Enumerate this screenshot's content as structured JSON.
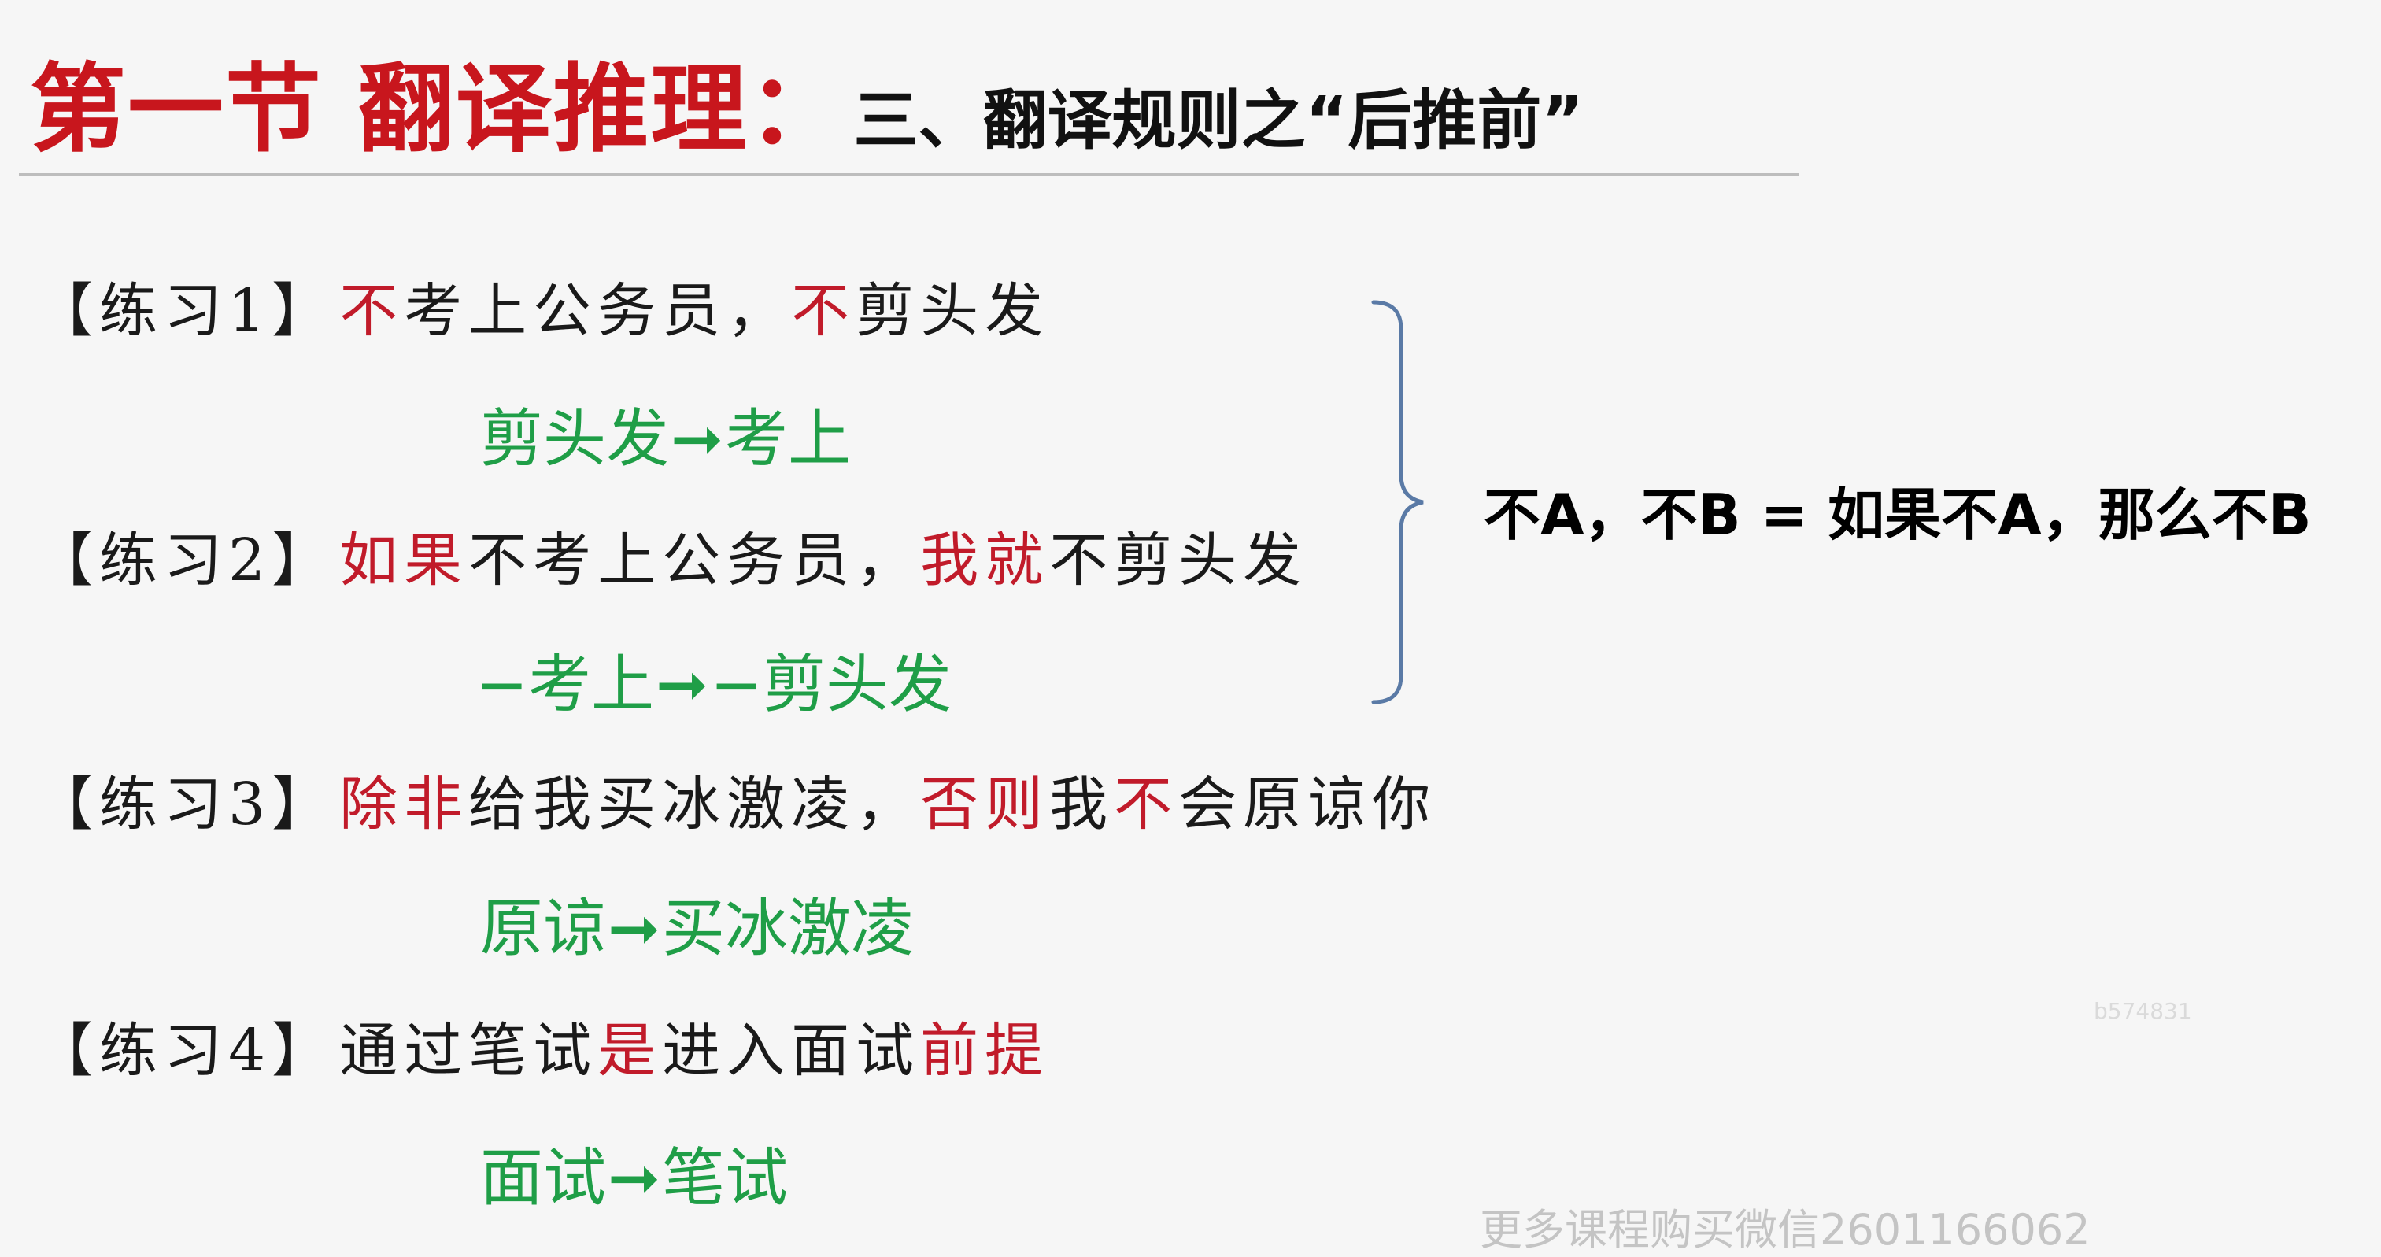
{
  "title": {
    "main": "第一节 翻译推理：",
    "sub": "三、翻译规则之“后推前”"
  },
  "exercises": [
    {
      "label": "【练习1】",
      "sentence": [
        {
          "t": "不",
          "red": true
        },
        {
          "t": "考上公务员，",
          "red": false
        },
        {
          "t": "不",
          "red": true
        },
        {
          "t": "剪头发",
          "red": false
        }
      ],
      "answer": {
        "from": "剪头发",
        "arrow": "➞",
        "to": "考上"
      }
    },
    {
      "label": "【练习2】",
      "sentence": [
        {
          "t": "如果",
          "red": true
        },
        {
          "t": "不考上公务员，",
          "red": false
        },
        {
          "t": "我就",
          "red": true
        },
        {
          "t": "不剪头发",
          "red": false
        }
      ],
      "answer": {
        "from": "−考上",
        "arrow": "➞",
        "to": "−剪头发"
      }
    },
    {
      "label": "【练习3】",
      "sentence": [
        {
          "t": "除非",
          "red": true
        },
        {
          "t": "给我买冰激凌，",
          "red": false
        },
        {
          "t": "否则",
          "red": true
        },
        {
          "t": "我",
          "red": false
        },
        {
          "t": "不",
          "red": true
        },
        {
          "t": "会原谅你",
          "red": false
        }
      ],
      "answer": {
        "from": "原谅",
        "arrow": "➞",
        "to": "买冰激凌"
      }
    },
    {
      "label": "【练习4】",
      "sentence": [
        {
          "t": "通过笔试",
          "red": false
        },
        {
          "t": "是",
          "red": true
        },
        {
          "t": "进入面试",
          "red": false
        },
        {
          "t": "前提",
          "red": true
        }
      ],
      "answer": {
        "from": "面试",
        "arrow": "➞",
        "to": "笔试"
      }
    }
  ],
  "formula": "不A，不B = 如果不A，那么不B",
  "watermark_small": "b574831",
  "watermark_bottom": "更多课程购买微信2601166062",
  "colors": {
    "title_red": "#c8161d",
    "keyword_red": "#c11b2a",
    "answer_green": "#1f9e47",
    "brace_blue": "#5a7aa6"
  }
}
